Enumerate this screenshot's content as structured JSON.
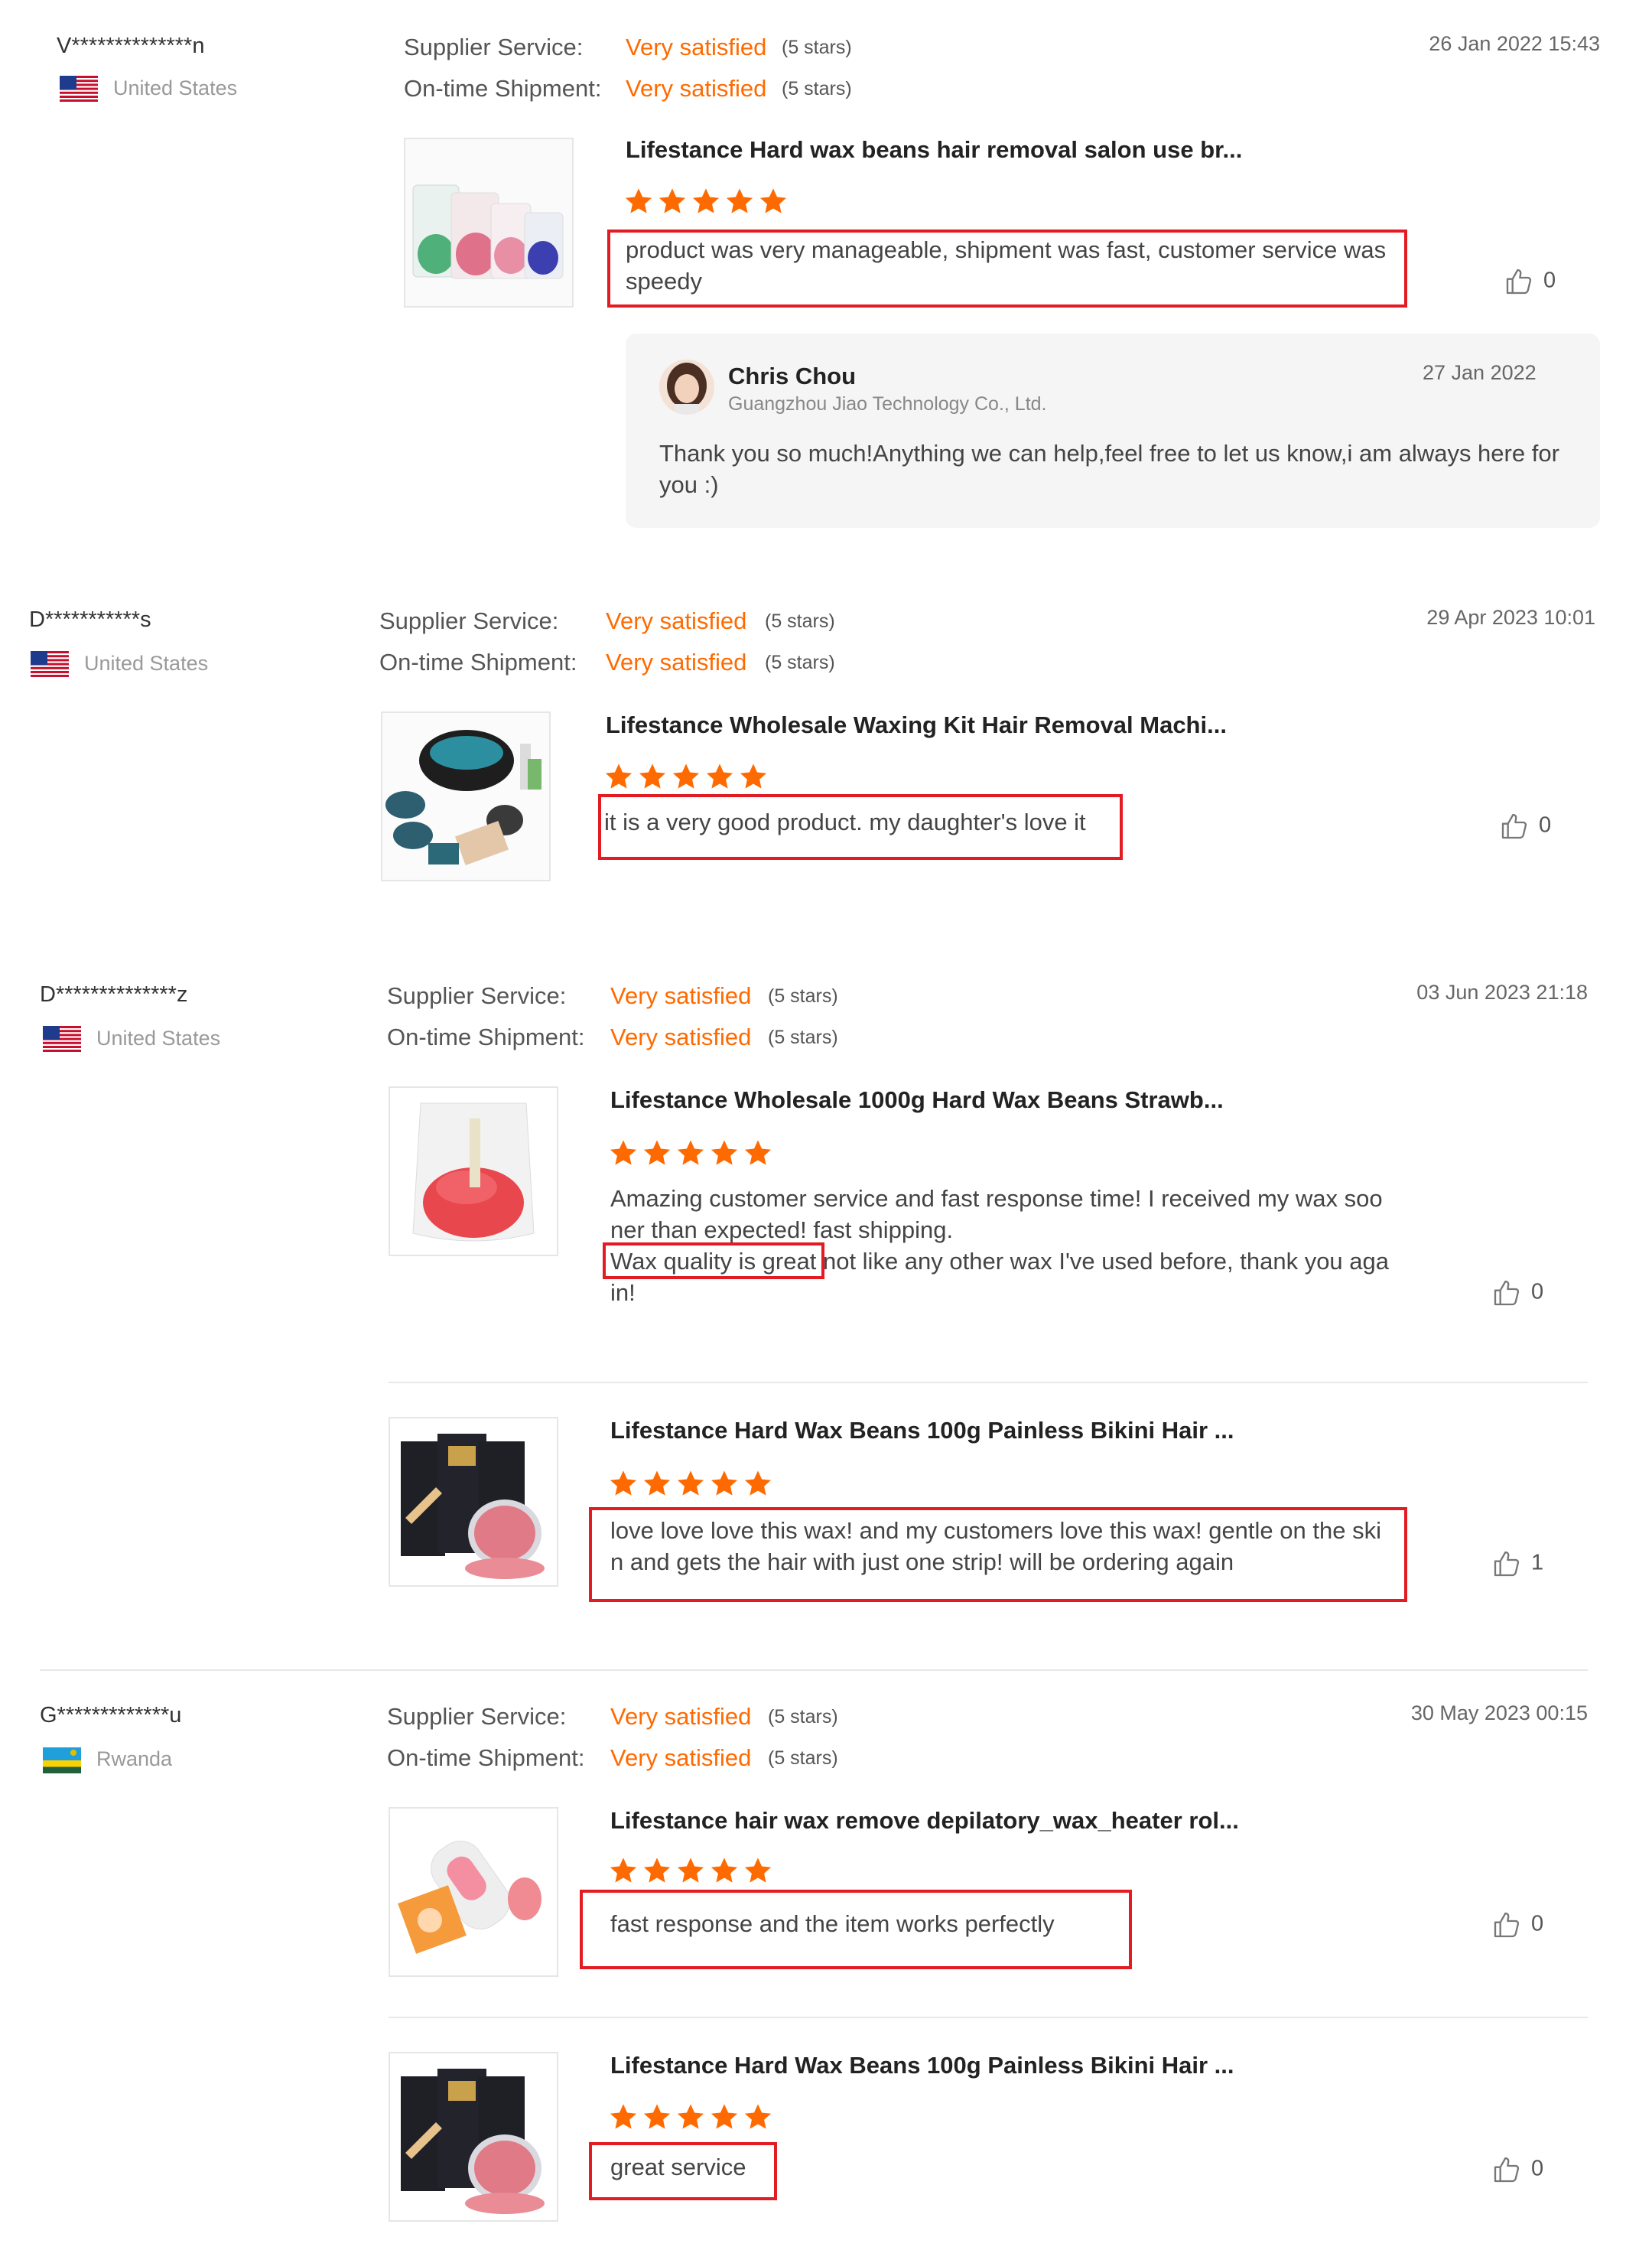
{
  "reviews": [
    {
      "user": "V**************n",
      "country": "United States",
      "supplier_label": "Supplier Service:",
      "supplier_value": "Very satisfied",
      "supplier_stars": "(5 stars)",
      "shipment_label": "On-time Shipment:",
      "shipment_value": "Very satisfied",
      "shipment_stars": "(5 stars)",
      "date": "26 Jan 2022 15:43",
      "items": [
        {
          "title": "Lifestance Hard wax beans hair removal salon use br...",
          "rating": 5,
          "comment": "product was very manageable, shipment was fast, customer service was speedy",
          "likes": "0"
        }
      ],
      "reply": {
        "name": "Chris Chou",
        "company": "Guangzhou Jiao Technology Co., Ltd.",
        "date": "27 Jan 2022",
        "text": "Thank you so much!Anything we can help,feel free to let us know,i am always here for you :)"
      }
    },
    {
      "user": "D***********s",
      "country": "United States",
      "supplier_label": "Supplier Service:",
      "supplier_value": "Very satisfied",
      "supplier_stars": "(5 stars)",
      "shipment_label": "On-time Shipment:",
      "shipment_value": "Very satisfied",
      "shipment_stars": "(5 stars)",
      "date": "29 Apr 2023 10:01",
      "items": [
        {
          "title": "Lifestance Wholesale Waxing Kit Hair Removal Machi...",
          "rating": 5,
          "comment": "it is a very good product. my daughter's love it",
          "likes": "0"
        }
      ]
    },
    {
      "user": "D**************z",
      "country": "United States",
      "supplier_label": "Supplier Service:",
      "supplier_value": "Very satisfied",
      "supplier_stars": "(5 stars)",
      "shipment_label": "On-time Shipment:",
      "shipment_value": "Very satisfied",
      "shipment_stars": "(5 stars)",
      "date": "03 Jun 2023 21:18",
      "items": [
        {
          "title": "Lifestance Wholesale 1000g Hard Wax Beans Strawb...",
          "rating": 5,
          "comment_line1": "Amazing customer service and fast response time! I received my wax soo",
          "comment_line2": "ner than expected! fast shipping.",
          "comment_highlight": "Wax quality is great",
          "comment_line3_rest": " not like any other wax I've used before, thank you aga",
          "comment_line4": "in!",
          "likes": "0"
        },
        {
          "title": "Lifestance Hard Wax Beans 100g Painless Bikini Hair ...",
          "rating": 5,
          "comment": "love love love this wax! and my customers love this wax! gentle on the skin and gets the hair with just one strip! will be ordering again",
          "likes": "1"
        }
      ]
    },
    {
      "user": "G*************u",
      "country": "Rwanda",
      "supplier_label": "Supplier Service:",
      "supplier_value": "Very satisfied",
      "supplier_stars": "(5 stars)",
      "shipment_label": "On-time Shipment:",
      "shipment_value": "Very satisfied",
      "shipment_stars": "(5 stars)",
      "date": "30 May 2023 00:15",
      "items": [
        {
          "title": "Lifestance hair wax remove depilatory_wax_heater rol...",
          "rating": 5,
          "comment": "fast response and the item works perfectly",
          "likes": "0"
        },
        {
          "title": "Lifestance Hard Wax Beans 100g Painless Bikini Hair ...",
          "rating": 5,
          "comment": "great service",
          "likes": "0"
        }
      ]
    }
  ],
  "icons": {
    "like": "thumbs-up-icon",
    "star": "star-icon",
    "flag_us": "us-flag-icon",
    "flag_rw": "rwanda-flag-icon"
  },
  "colors": {
    "accent": "#ff6a00",
    "highlight_box": "#e31b23",
    "star": "#ff6a00"
  }
}
